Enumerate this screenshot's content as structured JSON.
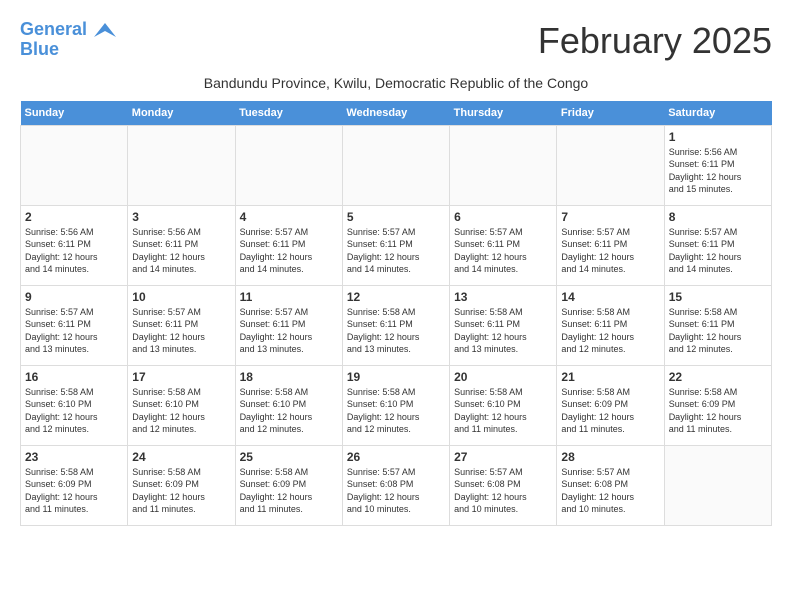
{
  "header": {
    "logo_line1": "General",
    "logo_line2": "Blue",
    "month_title": "February 2025",
    "location": "Bandundu Province, Kwilu, Democratic Republic of the Congo"
  },
  "days_of_week": [
    "Sunday",
    "Monday",
    "Tuesday",
    "Wednesday",
    "Thursday",
    "Friday",
    "Saturday"
  ],
  "weeks": [
    {
      "days": [
        {
          "num": "",
          "info": ""
        },
        {
          "num": "",
          "info": ""
        },
        {
          "num": "",
          "info": ""
        },
        {
          "num": "",
          "info": ""
        },
        {
          "num": "",
          "info": ""
        },
        {
          "num": "",
          "info": ""
        },
        {
          "num": "1",
          "info": "Sunrise: 5:56 AM\nSunset: 6:11 PM\nDaylight: 12 hours\nand 15 minutes."
        }
      ]
    },
    {
      "days": [
        {
          "num": "2",
          "info": "Sunrise: 5:56 AM\nSunset: 6:11 PM\nDaylight: 12 hours\nand 14 minutes."
        },
        {
          "num": "3",
          "info": "Sunrise: 5:56 AM\nSunset: 6:11 PM\nDaylight: 12 hours\nand 14 minutes."
        },
        {
          "num": "4",
          "info": "Sunrise: 5:57 AM\nSunset: 6:11 PM\nDaylight: 12 hours\nand 14 minutes."
        },
        {
          "num": "5",
          "info": "Sunrise: 5:57 AM\nSunset: 6:11 PM\nDaylight: 12 hours\nand 14 minutes."
        },
        {
          "num": "6",
          "info": "Sunrise: 5:57 AM\nSunset: 6:11 PM\nDaylight: 12 hours\nand 14 minutes."
        },
        {
          "num": "7",
          "info": "Sunrise: 5:57 AM\nSunset: 6:11 PM\nDaylight: 12 hours\nand 14 minutes."
        },
        {
          "num": "8",
          "info": "Sunrise: 5:57 AM\nSunset: 6:11 PM\nDaylight: 12 hours\nand 14 minutes."
        }
      ]
    },
    {
      "days": [
        {
          "num": "9",
          "info": "Sunrise: 5:57 AM\nSunset: 6:11 PM\nDaylight: 12 hours\nand 13 minutes."
        },
        {
          "num": "10",
          "info": "Sunrise: 5:57 AM\nSunset: 6:11 PM\nDaylight: 12 hours\nand 13 minutes."
        },
        {
          "num": "11",
          "info": "Sunrise: 5:57 AM\nSunset: 6:11 PM\nDaylight: 12 hours\nand 13 minutes."
        },
        {
          "num": "12",
          "info": "Sunrise: 5:58 AM\nSunset: 6:11 PM\nDaylight: 12 hours\nand 13 minutes."
        },
        {
          "num": "13",
          "info": "Sunrise: 5:58 AM\nSunset: 6:11 PM\nDaylight: 12 hours\nand 13 minutes."
        },
        {
          "num": "14",
          "info": "Sunrise: 5:58 AM\nSunset: 6:11 PM\nDaylight: 12 hours\nand 12 minutes."
        },
        {
          "num": "15",
          "info": "Sunrise: 5:58 AM\nSunset: 6:11 PM\nDaylight: 12 hours\nand 12 minutes."
        }
      ]
    },
    {
      "days": [
        {
          "num": "16",
          "info": "Sunrise: 5:58 AM\nSunset: 6:10 PM\nDaylight: 12 hours\nand 12 minutes."
        },
        {
          "num": "17",
          "info": "Sunrise: 5:58 AM\nSunset: 6:10 PM\nDaylight: 12 hours\nand 12 minutes."
        },
        {
          "num": "18",
          "info": "Sunrise: 5:58 AM\nSunset: 6:10 PM\nDaylight: 12 hours\nand 12 minutes."
        },
        {
          "num": "19",
          "info": "Sunrise: 5:58 AM\nSunset: 6:10 PM\nDaylight: 12 hours\nand 12 minutes."
        },
        {
          "num": "20",
          "info": "Sunrise: 5:58 AM\nSunset: 6:10 PM\nDaylight: 12 hours\nand 11 minutes."
        },
        {
          "num": "21",
          "info": "Sunrise: 5:58 AM\nSunset: 6:09 PM\nDaylight: 12 hours\nand 11 minutes."
        },
        {
          "num": "22",
          "info": "Sunrise: 5:58 AM\nSunset: 6:09 PM\nDaylight: 12 hours\nand 11 minutes."
        }
      ]
    },
    {
      "days": [
        {
          "num": "23",
          "info": "Sunrise: 5:58 AM\nSunset: 6:09 PM\nDaylight: 12 hours\nand 11 minutes."
        },
        {
          "num": "24",
          "info": "Sunrise: 5:58 AM\nSunset: 6:09 PM\nDaylight: 12 hours\nand 11 minutes."
        },
        {
          "num": "25",
          "info": "Sunrise: 5:58 AM\nSunset: 6:09 PM\nDaylight: 12 hours\nand 11 minutes."
        },
        {
          "num": "26",
          "info": "Sunrise: 5:57 AM\nSunset: 6:08 PM\nDaylight: 12 hours\nand 10 minutes."
        },
        {
          "num": "27",
          "info": "Sunrise: 5:57 AM\nSunset: 6:08 PM\nDaylight: 12 hours\nand 10 minutes."
        },
        {
          "num": "28",
          "info": "Sunrise: 5:57 AM\nSunset: 6:08 PM\nDaylight: 12 hours\nand 10 minutes."
        },
        {
          "num": "",
          "info": ""
        }
      ]
    }
  ]
}
